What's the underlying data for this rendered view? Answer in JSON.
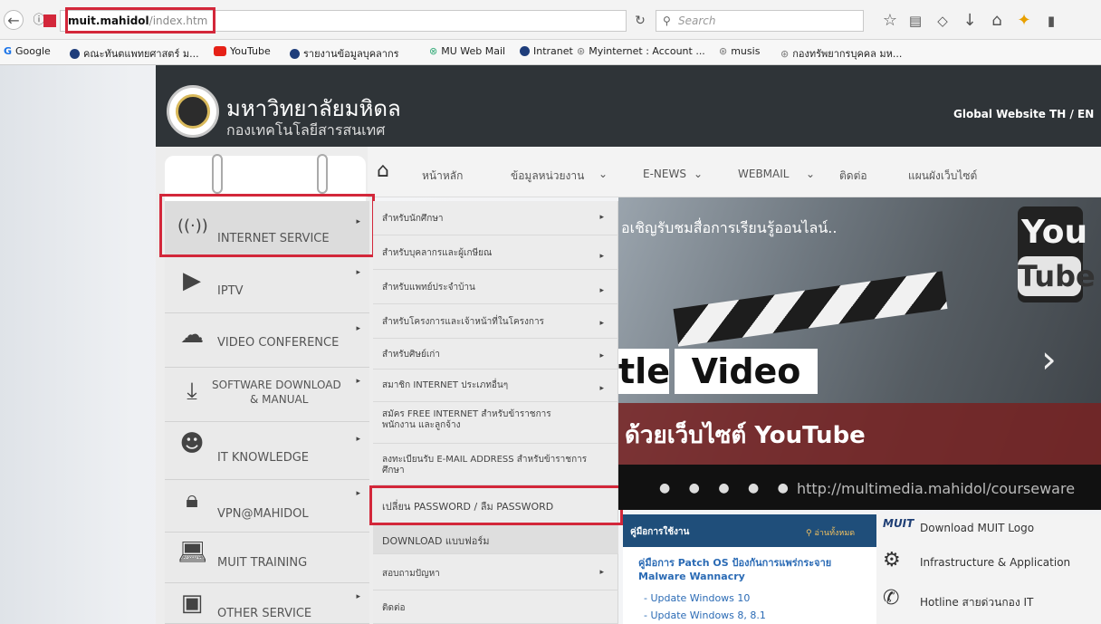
{
  "browser": {
    "url_host": "muit.mahidol",
    "url_path": "/index.htm",
    "search_placeholder": "Search"
  },
  "bookmarks": [
    {
      "label": "Google"
    },
    {
      "label": "คณะทันตแพทยศาสตร์ ม..."
    },
    {
      "label": "YouTube"
    },
    {
      "label": "รายงานข้อมูลบุคลากร"
    },
    {
      "label": "MU Web Mail"
    },
    {
      "label": "Intranet"
    },
    {
      "label": "Myinternet : Account ..."
    },
    {
      "label": "musis"
    },
    {
      "label": "กองทรัพยากรบุคคล มห..."
    }
  ],
  "header": {
    "university": "มหาวิทยาลัยมหิดล",
    "department": "กองเทคโนโลยีสารสนเทศ",
    "global": "Global Website TH / EN"
  },
  "nav": {
    "items": [
      "หน้าหลัก",
      "ข้อมูลหน่วยงาน",
      "E-NEWS",
      "WEBMAIL",
      "ติดต่อ",
      "แผนผังเว็บไซต์"
    ]
  },
  "leftmenu": {
    "items": [
      {
        "label": "INTERNET SERVICE"
      },
      {
        "label": "IPTV"
      },
      {
        "label": "VIDEO CONFERENCE"
      },
      {
        "label": "SOFTWARE DOWNLOAD",
        "label2": "& MANUAL"
      },
      {
        "label": "IT KNOWLEDGE"
      },
      {
        "label": "VPN@MAHIDOL"
      },
      {
        "label": "MUIT TRAINING"
      },
      {
        "label": "OTHER SERVICE"
      }
    ]
  },
  "submenu": {
    "items": [
      {
        "label": "สำหรับนักศึกษา"
      },
      {
        "label": "สำหรับบุคลากรและผู้เกษียณ"
      },
      {
        "label": "สำหรับแพทย์ประจำบ้าน"
      },
      {
        "label": "สำหรับโครงการและเจ้าหน้าที่ในโครงการ"
      },
      {
        "label": "สำหรับศิษย์เก่า"
      },
      {
        "label": "สมาชิก INTERNET ประเภทอื่นๆ"
      },
      {
        "label": "สมัคร FREE INTERNET สำหรับข้าราชการ",
        "label2": "พนักงาน และลูกจ้าง"
      },
      {
        "label": "ลงทะเบียนรับ E-MAIL ADDRESS สำหรับข้าราชการ",
        "label2": "ศึกษา"
      },
      {
        "label": "เปลี่ยน PASSWORD / ลืม PASSWORD"
      },
      {
        "label": "DOWNLOAD แบบฟอร์ม"
      },
      {
        "label": "สอบถามปัญหา"
      },
      {
        "label": "ติดต่อ"
      }
    ]
  },
  "banner": {
    "top": "อเชิญรับชมสื่อการเรียนรู้ออนไลน์..",
    "word1": "tle",
    "word2": "Video",
    "yt_line": "ด้วยเว็บไซต์ YouTube",
    "url": "http://multimedia.mahidol/courseware",
    "yt_you": "You",
    "yt_tube": "Tube"
  },
  "manual": {
    "title": "คู่มือการใช้งาน",
    "read_all": "อ่านทั้งหมด",
    "headline": "คู่มือการ Patch OS ป้องกันการแพร่กระจาย Malware Wannacry",
    "sub1": "- Update Windows 10",
    "sub2": "- Update Windows 8, 8.1"
  },
  "rightlinks": [
    {
      "label": "Download MUIT Logo",
      "prefix": "MUIT"
    },
    {
      "label": "Infrastructure & Application"
    },
    {
      "label": "Hotline สายด่วนกอง IT"
    }
  ]
}
